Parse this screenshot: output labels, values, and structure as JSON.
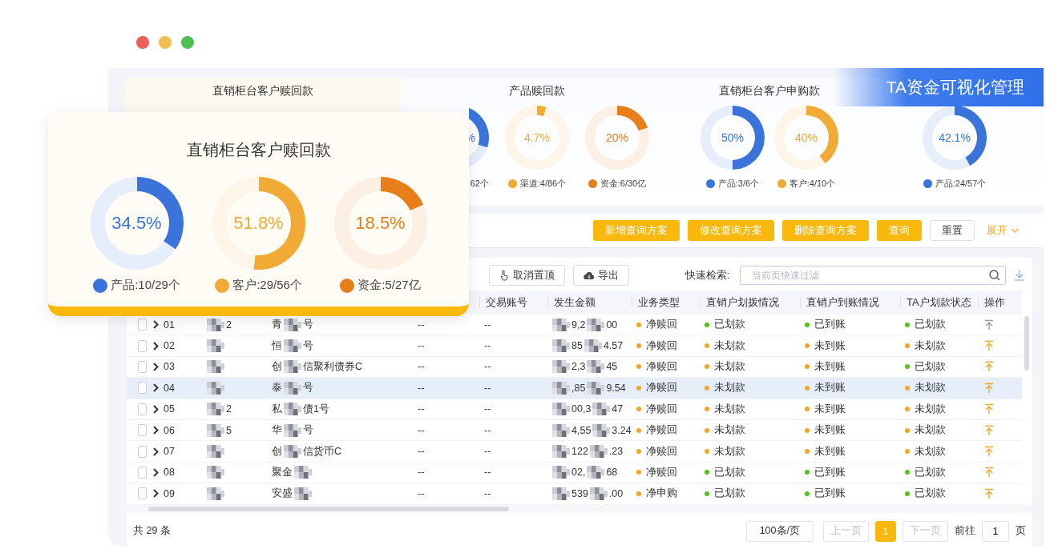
{
  "banner": {
    "title": "TA资金可视化管理"
  },
  "chart_groups": [
    {
      "title": "直销柜台客户赎回款"
    },
    {
      "title": "产品赎回款",
      "donuts": [
        {
          "kind": "partial",
          "value": "%",
          "color": "#3a74db",
          "legend": "62个"
        },
        {
          "kind": "donut",
          "value": "4.7%",
          "color": "#f0aa35",
          "legend": "渠道:4/86个",
          "chart_data": {
            "type": "donut",
            "values": [
              4.7,
              95.3
            ]
          }
        },
        {
          "kind": "donut",
          "value": "20%",
          "color": "#e87e1a",
          "legend": "资金:6/30亿",
          "chart_data": {
            "type": "donut",
            "values": [
              20,
              80
            ]
          }
        }
      ]
    },
    {
      "title": "直销柜台客户申购款",
      "donuts": [
        {
          "kind": "donut",
          "value": "50%",
          "color": "#3a74db",
          "legend": "产品:3/6个",
          "chart_data": {
            "type": "donut",
            "values": [
              50,
              50
            ]
          }
        },
        {
          "kind": "donut",
          "value": "40%",
          "color": "#f0aa35",
          "legend": "客户:4/10个",
          "chart_data": {
            "type": "donut",
            "values": [
              40,
              60
            ]
          }
        }
      ]
    },
    {
      "donuts": [
        {
          "kind": "donut",
          "value": "42.1%",
          "color": "#3a74db",
          "legend": "产品:24/57个",
          "chart_data": {
            "type": "donut",
            "values": [
              42.1,
              57.9
            ]
          }
        }
      ]
    }
  ],
  "filter_buttons": [
    {
      "kind": "primary",
      "label": "新增查询方案"
    },
    {
      "kind": "primary",
      "label": "修改查询方案"
    },
    {
      "kind": "primary",
      "label": "删除查询方案"
    },
    {
      "kind": "primary",
      "label": "查询"
    },
    {
      "kind": "plain",
      "label": "重置"
    },
    {
      "kind": "link",
      "label": "展开"
    }
  ],
  "table_toolbar": {
    "unpin_button": "取消置顶",
    "export_button": "导出",
    "search_label": "快速检索:",
    "search": {
      "placeholder": "当前页快速过滤"
    }
  },
  "table": {
    "columns": [
      "交易账号",
      "发生金额",
      "业务类型",
      "直销户划拨情况",
      "直销户到账情况",
      "TA户划款状态",
      "操作"
    ],
    "rows": [
      {
        "selected": false,
        "column_2": "01",
        "column_3": [
          {
            "kind": "blur"
          },
          {
            "kind": "text",
            "text": "2"
          }
        ],
        "column_4": [
          {
            "kind": "text",
            "text": "青"
          },
          {
            "kind": "blur"
          },
          {
            "kind": "text",
            "text": "号"
          }
        ],
        "column_5": "--",
        "account": "--",
        "amount": [
          {
            "kind": "blur"
          },
          {
            "kind": "text",
            "text": "9,2"
          },
          {
            "kind": "blur"
          },
          {
            "kind": "text",
            "text": "00"
          }
        ],
        "type": {
          "text": "净赎回",
          "color": "#f5a623"
        },
        "transfer": {
          "text": "已划款",
          "color": "#52c41a"
        },
        "arrival": {
          "text": "已到账",
          "color": "#52c41a"
        },
        "ta": {
          "text": "已划款",
          "color": "#52c41a"
        },
        "pin_disabled": true
      },
      {
        "selected": false,
        "column_2": "02",
        "column_3": [
          {
            "kind": "blur"
          }
        ],
        "column_4": [
          {
            "kind": "text",
            "text": "恒"
          },
          {
            "kind": "blur"
          },
          {
            "kind": "text",
            "text": "号"
          }
        ],
        "column_5": "--",
        "account": "--",
        "amount": [
          {
            "kind": "blur"
          },
          {
            "kind": "text",
            "text": "85"
          },
          {
            "kind": "blur"
          },
          {
            "kind": "text",
            "text": "4.57"
          }
        ],
        "type": {
          "text": "净赎回",
          "color": "#f5a623"
        },
        "transfer": {
          "text": "未划款",
          "color": "#f5a623"
        },
        "arrival": {
          "text": "未到账",
          "color": "#f5a623"
        },
        "ta": {
          "text": "未划款",
          "color": "#f5a623"
        },
        "pin_disabled": false
      },
      {
        "selected": false,
        "column_2": "03",
        "column_3": [
          {
            "kind": "blur"
          }
        ],
        "column_4": [
          {
            "kind": "text",
            "text": "创"
          },
          {
            "kind": "blur"
          },
          {
            "kind": "text",
            "text": "信聚利债券C"
          }
        ],
        "column_5": "--",
        "account": "--",
        "amount": [
          {
            "kind": "blur"
          },
          {
            "kind": "text",
            "text": "2,3"
          },
          {
            "kind": "blur"
          },
          {
            "kind": "text",
            "text": "45"
          }
        ],
        "type": {
          "text": "净赎回",
          "color": "#f5a623"
        },
        "transfer": {
          "text": "未划款",
          "color": "#f5a623"
        },
        "arrival": {
          "text": "未到账",
          "color": "#f5a623"
        },
        "ta": {
          "text": "已划款",
          "color": "#52c41a"
        },
        "pin_disabled": false
      },
      {
        "selected": true,
        "column_2": "04",
        "column_3": [
          {
            "kind": "blur"
          }
        ],
        "column_4": [
          {
            "kind": "text",
            "text": "泰"
          },
          {
            "kind": "blur"
          },
          {
            "kind": "text",
            "text": "号"
          }
        ],
        "column_5": "--",
        "account": "--",
        "amount": [
          {
            "kind": "blur"
          },
          {
            "kind": "text",
            "text": ",85"
          },
          {
            "kind": "blur"
          },
          {
            "kind": "text",
            "text": "9.54"
          }
        ],
        "type": {
          "text": "净赎回",
          "color": "#f5a623"
        },
        "transfer": {
          "text": "未划款",
          "color": "#f5a623"
        },
        "arrival": {
          "text": "未到账",
          "color": "#f5a623"
        },
        "ta": {
          "text": "未划款",
          "color": "#f5a623"
        },
        "pin_disabled": false
      },
      {
        "selected": false,
        "column_2": "05",
        "column_3": [
          {
            "kind": "blur"
          },
          {
            "kind": "text",
            "text": "2"
          }
        ],
        "column_4": [
          {
            "kind": "text",
            "text": "私"
          },
          {
            "kind": "blur"
          },
          {
            "kind": "text",
            "text": "债1号"
          }
        ],
        "column_5": "--",
        "account": "--",
        "amount": [
          {
            "kind": "blur"
          },
          {
            "kind": "text",
            "text": "00,3"
          },
          {
            "kind": "blur"
          },
          {
            "kind": "text",
            "text": "47"
          }
        ],
        "type": {
          "text": "净赎回",
          "color": "#f5a623"
        },
        "transfer": {
          "text": "未划款",
          "color": "#f5a623"
        },
        "arrival": {
          "text": "未到账",
          "color": "#f5a623"
        },
        "ta": {
          "text": "未划款",
          "color": "#f5a623"
        },
        "pin_disabled": false
      },
      {
        "selected": false,
        "column_2": "06",
        "column_3": [
          {
            "kind": "blur"
          },
          {
            "kind": "text",
            "text": "5"
          }
        ],
        "column_4": [
          {
            "kind": "text",
            "text": "华"
          },
          {
            "kind": "blur"
          },
          {
            "kind": "text",
            "text": "号"
          }
        ],
        "column_5": "--",
        "account": "--",
        "amount": [
          {
            "kind": "blur"
          },
          {
            "kind": "text",
            "text": "4,55"
          },
          {
            "kind": "blur"
          },
          {
            "kind": "text",
            "text": "3.24"
          }
        ],
        "type": {
          "text": "净赎回",
          "color": "#f5a623"
        },
        "transfer": {
          "text": "未划款",
          "color": "#f5a623"
        },
        "arrival": {
          "text": "未到账",
          "color": "#f5a623"
        },
        "ta": {
          "text": "未划款",
          "color": "#f5a623"
        },
        "pin_disabled": false
      },
      {
        "selected": false,
        "column_2": "07",
        "column_3": [
          {
            "kind": "blur"
          }
        ],
        "column_4": [
          {
            "kind": "text",
            "text": "创"
          },
          {
            "kind": "blur"
          },
          {
            "kind": "text",
            "text": "信货币C"
          }
        ],
        "column_5": "--",
        "account": "--",
        "amount": [
          {
            "kind": "blur"
          },
          {
            "kind": "text",
            "text": "122"
          },
          {
            "kind": "blur"
          },
          {
            "kind": "text",
            "text": ".23"
          }
        ],
        "type": {
          "text": "净赎回",
          "color": "#f5a623"
        },
        "transfer": {
          "text": "未划款",
          "color": "#f5a623"
        },
        "arrival": {
          "text": "未到账",
          "color": "#f5a623"
        },
        "ta": {
          "text": "未划款",
          "color": "#f5a623"
        },
        "pin_disabled": false
      },
      {
        "selected": false,
        "column_2": "08",
        "column_3": [
          {
            "kind": "blur"
          }
        ],
        "column_4": [
          {
            "kind": "text",
            "text": "聚金"
          },
          {
            "kind": "blur"
          }
        ],
        "column_5": "--",
        "account": "--",
        "amount": [
          {
            "kind": "blur"
          },
          {
            "kind": "text",
            "text": "02,"
          },
          {
            "kind": "blur"
          },
          {
            "kind": "text",
            "text": "68"
          }
        ],
        "type": {
          "text": "净赎回",
          "color": "#f5a623"
        },
        "transfer": {
          "text": "已划款",
          "color": "#52c41a"
        },
        "arrival": {
          "text": "已到账",
          "color": "#52c41a"
        },
        "ta": {
          "text": "已划款",
          "color": "#52c41a"
        },
        "pin_disabled": false
      },
      {
        "selected": false,
        "column_2": "09",
        "column_3": [
          {
            "kind": "blur"
          }
        ],
        "column_4": [
          {
            "kind": "text",
            "text": "安盛"
          },
          {
            "kind": "blur"
          }
        ],
        "column_5": "--",
        "account": "--",
        "amount": [
          {
            "kind": "blur"
          },
          {
            "kind": "text",
            "text": "539"
          },
          {
            "kind": "blur"
          },
          {
            "kind": "text",
            "text": ".00"
          }
        ],
        "type": {
          "text": "净申购",
          "color": "#f5a623"
        },
        "transfer": {
          "text": "已划款",
          "color": "#52c41a"
        },
        "arrival": {
          "text": "已到账",
          "color": "#52c41a"
        },
        "ta": {
          "text": "已划款",
          "color": "#52c41a"
        },
        "pin_disabled": false
      }
    ]
  },
  "pagination": {
    "total": "共 29 条",
    "page_size": "100条/页",
    "prev": "上一页",
    "pages": [
      {
        "label": "1",
        "selected": true
      }
    ],
    "next": "下一页",
    "goto_label": "前往",
    "goto_value": "1",
    "goto_suffix": "页"
  },
  "card": {
    "title": "直销柜台客户赎回款",
    "donuts": [
      {
        "kind": "donut",
        "value": "34.5%",
        "color": "#3a74db",
        "legend": "产品:10/29个",
        "chart_data": {
          "type": "donut",
          "values": [
            34.5,
            65.5
          ]
        }
      },
      {
        "kind": "donut",
        "value": "51.8%",
        "color": "#f0aa35",
        "legend": "客户:29/56个",
        "chart_data": {
          "type": "donut",
          "values": [
            51.8,
            48.2
          ]
        }
      },
      {
        "kind": "donut",
        "value": "18.5%",
        "color": "#e87e1a",
        "legend": "资金:5/27亿",
        "chart_data": {
          "type": "donut",
          "values": [
            18.5,
            81.5
          ]
        }
      }
    ]
  }
}
